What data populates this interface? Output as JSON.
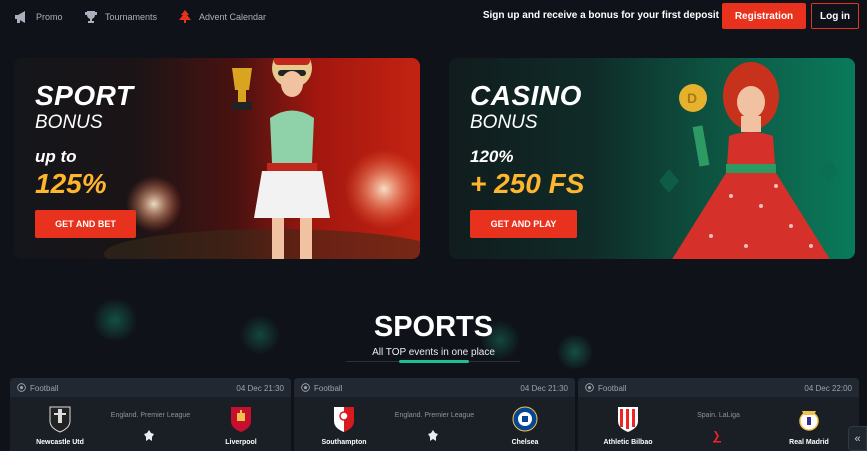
{
  "header": {
    "nav": [
      {
        "label": "Promo",
        "icon": "megaphone-icon"
      },
      {
        "label": "Tournaments",
        "icon": "trophy-icon"
      },
      {
        "label": "Advent Calendar",
        "icon": "christmas-tree-icon"
      }
    ],
    "promo_text": "Sign up and receive a bonus for your first deposit",
    "register_label": "Registration",
    "login_label": "Log in"
  },
  "banners": {
    "sport": {
      "title": "SPORT",
      "subtitle": "BONUS",
      "line1": "up to",
      "line2": "125%",
      "cta": "GET AND BET"
    },
    "casino": {
      "title": "CASINO",
      "subtitle": "BONUS",
      "line1": "120%",
      "line2": "+ 250 FS",
      "cta": "GET AND PLAY"
    }
  },
  "sports": {
    "title": "SPORTS",
    "subtitle": "All TOP events in one place"
  },
  "matches": [
    {
      "sport": "Football",
      "date": "04 Dec 21:30",
      "league": "England. Premier League",
      "home": "Newcastle Utd",
      "away": "Liverpool"
    },
    {
      "sport": "Football",
      "date": "04 Dec 21:30",
      "league": "England. Premier League",
      "home": "Southampton",
      "away": "Chelsea"
    },
    {
      "sport": "Football",
      "date": "04 Dec 22:00",
      "league": "Spain. LaLiga",
      "home": "Athletic Bilbao",
      "away": "Real Madrid"
    }
  ],
  "colors": {
    "background": "#0f1319",
    "accent_red": "#e8321d",
    "accent_gold": "#ffb52e",
    "accent_green": "#1fbf8f"
  }
}
